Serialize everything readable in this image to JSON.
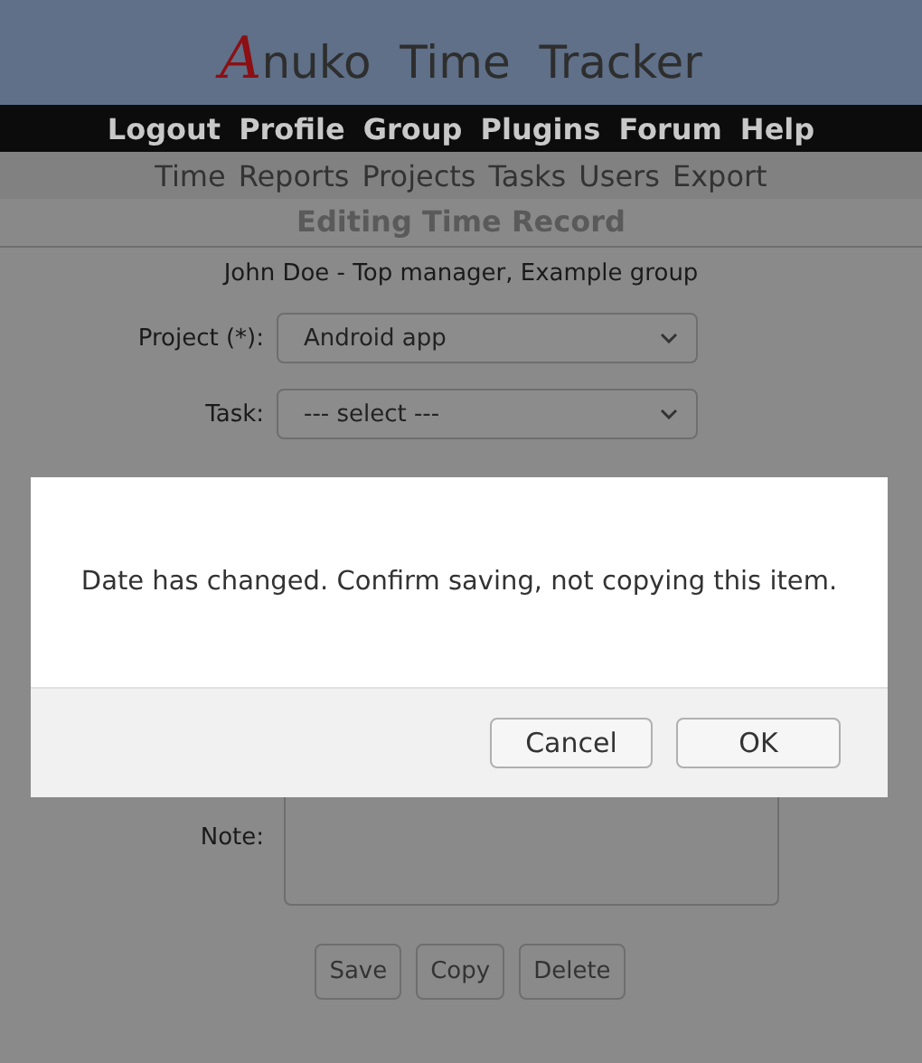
{
  "logo": {
    "initial": "A",
    "rest": "nuko  Time  Tracker"
  },
  "top_menu": [
    "Logout",
    "Profile",
    "Group",
    "Plugins",
    "Forum",
    "Help"
  ],
  "sub_menu": [
    "Time",
    "Reports",
    "Projects",
    "Tasks",
    "Users",
    "Export"
  ],
  "page_title": "Editing Time Record",
  "user_line": "John Doe - Top manager, Example group",
  "fields": [
    {
      "label": "Project (*):",
      "value": "Android app",
      "kind": "select"
    },
    {
      "label": "Task:",
      "value": "--- select ---",
      "kind": "select"
    }
  ],
  "note": {
    "label": "Note:"
  },
  "buttons": [
    "Save",
    "Copy",
    "Delete"
  ],
  "dialog": {
    "message": "Date has changed. Confirm saving, not copying this item.",
    "buttons": [
      "Cancel",
      "OK"
    ]
  }
}
